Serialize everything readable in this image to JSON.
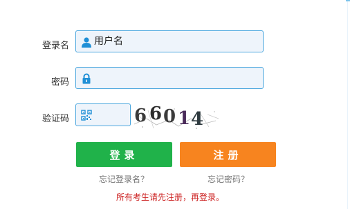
{
  "form": {
    "username_label": "登录名",
    "username_placeholder": "用户名",
    "password_label": "密码",
    "password_placeholder": "",
    "captcha_label": "验证码",
    "captcha_placeholder": "",
    "captcha_text": "66014"
  },
  "buttons": {
    "login": "登录",
    "register": "注册"
  },
  "links": {
    "forgot_username": "忘记登录名？",
    "forgot_password": "忘记密码？"
  },
  "notice": "所有考生请先注册，再登录。",
  "colors": {
    "field_border": "#4aa6de",
    "field_bg": "#eef4fb",
    "icon_blue": "#1f8fd6",
    "login_green": "#20b24a",
    "register_orange": "#f7841f",
    "notice_red": "#cc1f1f"
  }
}
